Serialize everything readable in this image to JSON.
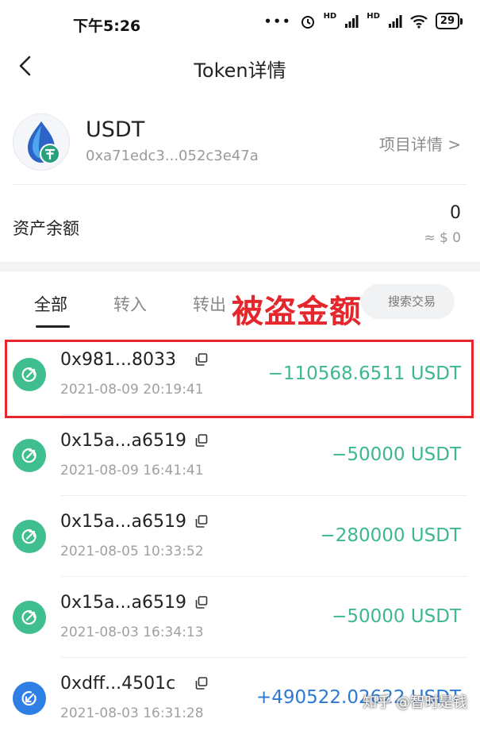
{
  "status_bar": {
    "time": "下午5:26",
    "battery": "29",
    "signal_label_1": "HD",
    "signal_label_2": "HD"
  },
  "nav": {
    "title": "Token详情"
  },
  "token": {
    "name": "USDT",
    "address": "0xa71edc3...052c3e47a",
    "project_link": "项目详情 >"
  },
  "asset": {
    "label": "资产余额",
    "balance": "0",
    "fiat": "≈ $ 0"
  },
  "tabs": [
    {
      "label": "全部",
      "active": true
    },
    {
      "label": "转入",
      "active": false
    },
    {
      "label": "转出",
      "active": false
    }
  ],
  "search": {
    "placeholder": "搜索交易"
  },
  "annotation": {
    "text": "被盗金额",
    "color": "#e5262c"
  },
  "transactions": [
    {
      "hash": "0x981...8033",
      "time": "2021-08-09 20:19:41",
      "amount": "−110568.6511 USDT",
      "direction": "out"
    },
    {
      "hash": "0x15a...a6519",
      "time": "2021-08-09 16:41:41",
      "amount": "−50000 USDT",
      "direction": "out"
    },
    {
      "hash": "0x15a...a6519",
      "time": "2021-08-05 10:33:52",
      "amount": "−280000 USDT",
      "direction": "out"
    },
    {
      "hash": "0x15a...a6519",
      "time": "2021-08-03 16:34:13",
      "amount": "−50000 USDT",
      "direction": "out"
    },
    {
      "hash": "0xdff...4501c",
      "time": "2021-08-03 16:31:28",
      "amount": "+490522.02622 USDT",
      "direction": "in"
    }
  ],
  "watermark": "知乎 @智时是钱",
  "colors": {
    "out": "#3cb98a",
    "in": "#2b79d6",
    "accent_red": "#e5262c",
    "tether_green": "#26a17b"
  }
}
